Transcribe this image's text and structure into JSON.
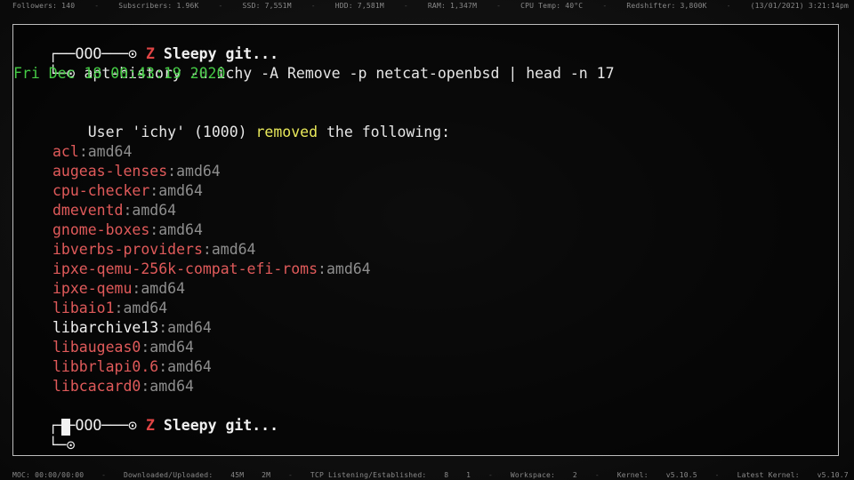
{
  "status_top": [
    "Followers: 140",
    "Subscribers: 1.96K",
    "SSD:   7,551M",
    "HDD:   7,581M",
    "RAM:  1,347M",
    "CPU Temp:  40°C",
    "Redshifter:  3,800K",
    "(13/01/2021)  3:21:14pm"
  ],
  "status_bottom": [
    "MOC: 00:00/00:00",
    "Downloaded/Uploaded:",
    "45M",
    "2M",
    "TCP Listening/Established:",
    "8",
    "1",
    "Workspace:",
    "2",
    "Kernel:",
    "v5.10.5",
    "Latest Kernel:",
    "v5.10.7"
  ],
  "prompt": {
    "top_glyph": "┌──OOO───⊙",
    "z_icon": "Z",
    "name": "Sleepy git...",
    "bottom_glyph": "└─⊙"
  },
  "command": "apt-history -u ichy -A Remove -p netcat-openbsd | head -n 17",
  "date_line": "Fri Dec 18 00:43:19 2020",
  "removal_line": {
    "prefix": "User 'ichy' (1000) ",
    "action": "removed",
    "suffix": " the following:"
  },
  "packages": [
    {
      "name": "acl",
      "arch": ":amd64",
      "color": "red"
    },
    {
      "name": "augeas-lenses",
      "arch": ":amd64",
      "color": "red"
    },
    {
      "name": "cpu-checker",
      "arch": ":amd64",
      "color": "red"
    },
    {
      "name": "dmeventd",
      "arch": ":amd64",
      "color": "red"
    },
    {
      "name": "gnome-boxes",
      "arch": ":amd64",
      "color": "red"
    },
    {
      "name": "ibverbs-providers",
      "arch": ":amd64",
      "color": "red"
    },
    {
      "name": "ipxe-qemu-256k-compat-efi-roms",
      "arch": ":amd64",
      "color": "red"
    },
    {
      "name": "ipxe-qemu",
      "arch": ":amd64",
      "color": "red"
    },
    {
      "name": "libaio1",
      "arch": ":amd64",
      "color": "red"
    },
    {
      "name": "libarchive13",
      "arch": ":amd64",
      "color": "white"
    },
    {
      "name": "libaugeas0",
      "arch": ":amd64",
      "color": "red"
    },
    {
      "name": "libbrlapi0.6",
      "arch": ":amd64",
      "color": "red"
    },
    {
      "name": "libcacard0",
      "arch": ":amd64",
      "color": "red"
    }
  ]
}
